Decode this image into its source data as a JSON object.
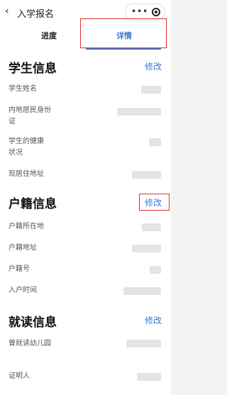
{
  "header": {
    "back_icon": "‹",
    "title": "入学报名",
    "more_icon": "•••"
  },
  "tabs": [
    {
      "label": "进度"
    },
    {
      "label": "详情"
    }
  ],
  "sections": {
    "student": {
      "title": "学生信息",
      "edit": "修改",
      "fields": [
        {
          "label": "学生姓名"
        },
        {
          "label": "内地居民身份证"
        },
        {
          "label": "学生的健康状况"
        },
        {
          "label": "现居住地址"
        }
      ]
    },
    "household": {
      "title": "户籍信息",
      "edit": "修改",
      "fields": [
        {
          "label": "户籍所在地"
        },
        {
          "label": "户籍地址"
        },
        {
          "label": "户籍号"
        },
        {
          "label": "入户时间"
        }
      ]
    },
    "school": {
      "title": "就读信息",
      "edit": "修改",
      "fields": [
        {
          "label": "曾就读幼儿园"
        },
        {
          "label": "证明人"
        }
      ]
    }
  },
  "colors": {
    "accent": "#3a7bd5",
    "highlight": "#e03030"
  }
}
